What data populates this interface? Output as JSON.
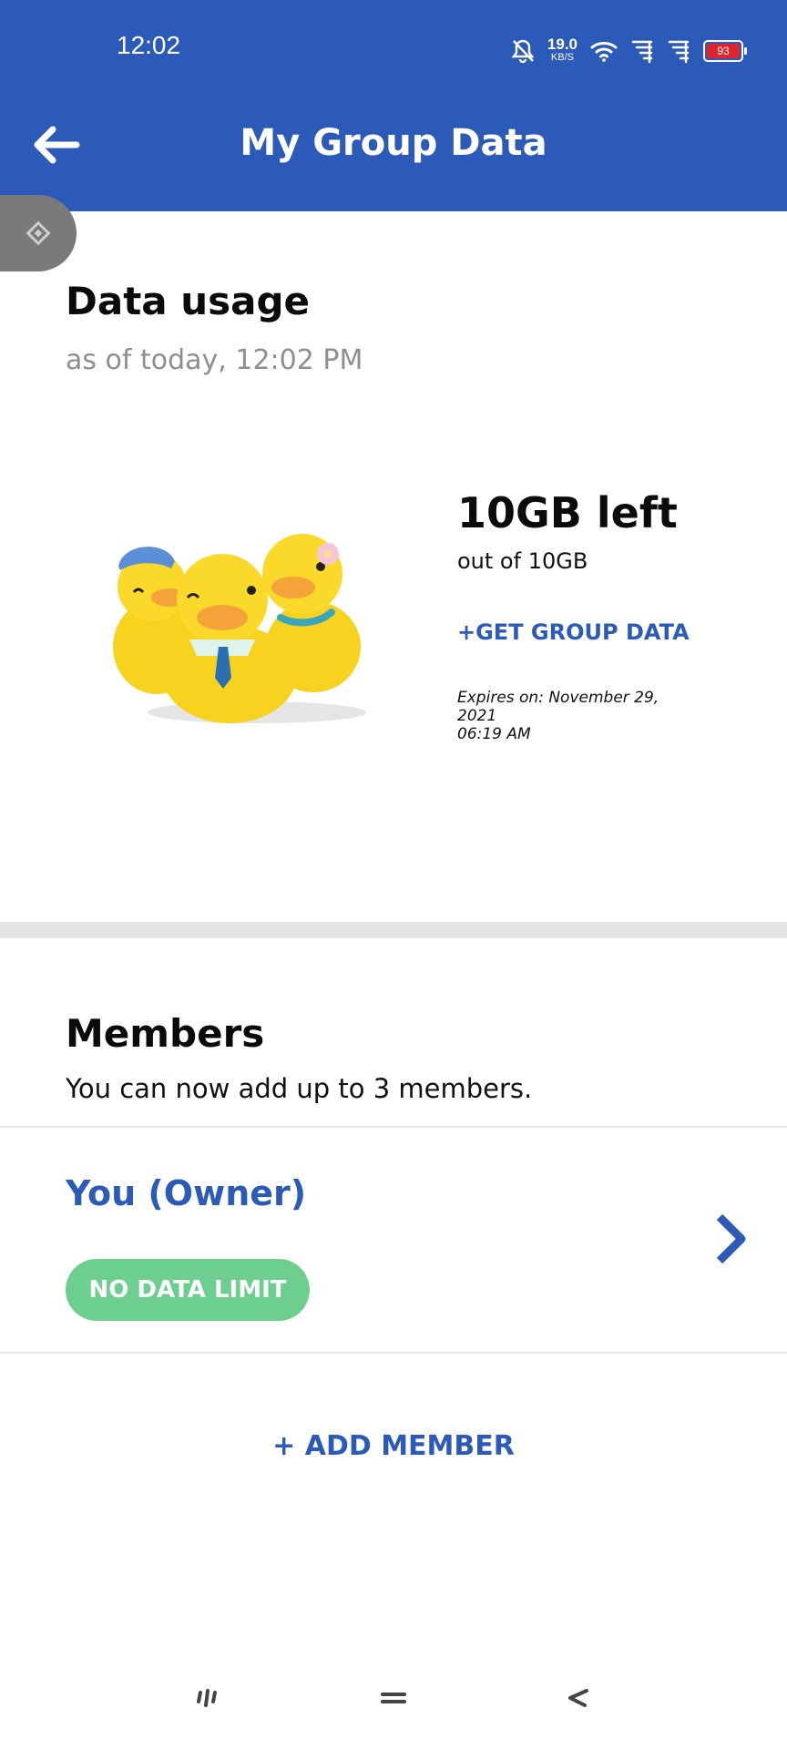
{
  "status_bar": {
    "time": "12:02",
    "speed_value": "19.0",
    "speed_unit": "KB/S",
    "battery": "93",
    "icons": [
      "bell-off-icon",
      "wifi-icon",
      "signal-icon",
      "signal-icon",
      "battery-icon"
    ]
  },
  "header": {
    "title": "My Group Data",
    "back_icon": "back-arrow-icon"
  },
  "data_usage": {
    "title": "Data usage",
    "as_of": "as of today, 12:02 PM",
    "left": "10GB left",
    "out_of": "out of 10GB",
    "get_group_data": "+GET GROUP DATA",
    "expires_line1": "Expires on: November 29, 2021",
    "expires_line2": "06:19 AM"
  },
  "members": {
    "title": "Members",
    "subtitle": "You can now add up to 3 members.",
    "list": [
      {
        "name": "You (Owner)",
        "badge": "NO DATA LIMIT"
      }
    ],
    "add_label": "+ ADD MEMBER"
  },
  "colors": {
    "brand": "#2b5ab8",
    "badge_green": "#6dcf8f",
    "battery_red": "#e0242d"
  }
}
